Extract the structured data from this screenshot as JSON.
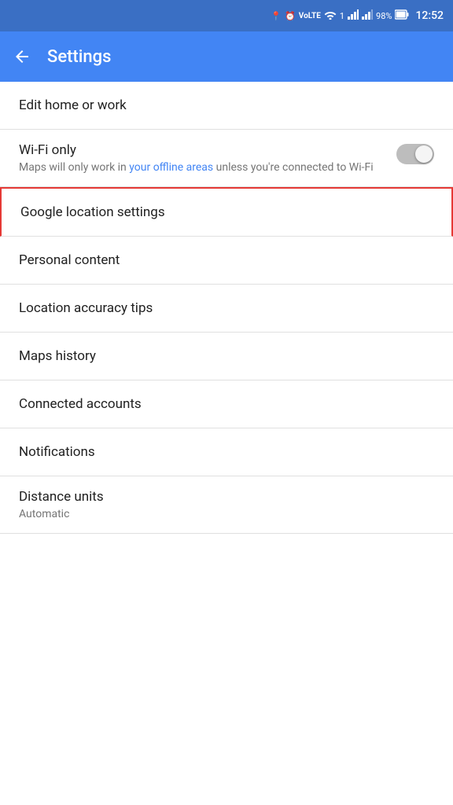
{
  "statusBar": {
    "time": "12:52",
    "battery": "98%"
  },
  "appBar": {
    "title": "Settings",
    "backLabel": "←"
  },
  "settingsItems": [
    {
      "id": "edit-home-work",
      "title": "Edit home or work",
      "subtitle": null,
      "highlighted": false
    },
    {
      "id": "wifi-only",
      "title": "Wi-Fi only",
      "subtitle": "Maps will only work in your offline areas unless you're connected to Wi-Fi",
      "subtitleLinkText": "your offline areas",
      "hasToggle": true,
      "toggleOn": false,
      "highlighted": false
    },
    {
      "id": "google-location-settings",
      "title": "Google location settings",
      "subtitle": null,
      "highlighted": true
    },
    {
      "id": "personal-content",
      "title": "Personal content",
      "subtitle": null,
      "highlighted": false
    },
    {
      "id": "location-accuracy-tips",
      "title": "Location accuracy tips",
      "subtitle": null,
      "highlighted": false
    },
    {
      "id": "maps-history",
      "title": "Maps history",
      "subtitle": null,
      "highlighted": false
    },
    {
      "id": "connected-accounts",
      "title": "Connected accounts",
      "subtitle": null,
      "highlighted": false
    },
    {
      "id": "notifications",
      "title": "Notifications",
      "subtitle": null,
      "highlighted": false
    },
    {
      "id": "distance-units",
      "title": "Distance units",
      "subtitle": "Automatic",
      "highlighted": false
    }
  ],
  "icons": {
    "location": "📍",
    "alarm": "⏰",
    "wifi": "wifi",
    "signal": "signal",
    "battery": "🔋"
  }
}
